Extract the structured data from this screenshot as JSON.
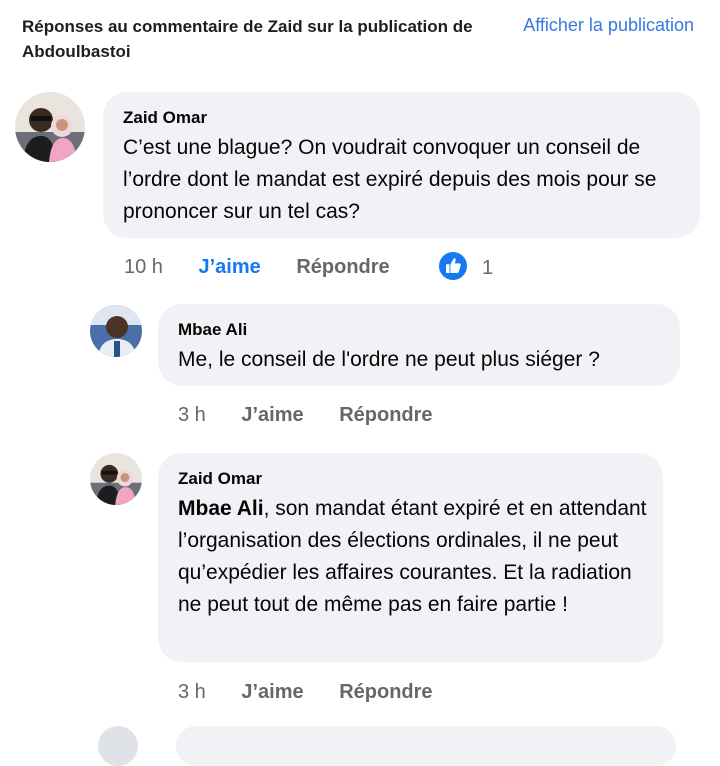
{
  "header": {
    "title": "Réponses au commentaire de Zaid sur la publication de Abdoulbastoi",
    "show_post": "Afficher la publication"
  },
  "comments": [
    {
      "author": "Zaid Omar",
      "text": "C’est une blague? On voudrait convoquer un conseil de l’ordre dont le mandat est expiré depuis des mois pour se prononcer sur un tel cas?",
      "time": "10 h",
      "like_label": "J’aime",
      "reply_label": "Répondre",
      "reactions_count": "1",
      "reaction_icon": "thumbs-up-icon"
    },
    {
      "author": "Mbae Ali",
      "text": "Me, le conseil de l'ordre ne peut plus siéger ?",
      "time": "3 h",
      "like_label": "J’aime",
      "reply_label": "Répondre"
    },
    {
      "author": "Zaid Omar",
      "mention": "Mbae Ali",
      "text": ", son mandat étant expiré et en attendant l’organisation des élections ordinales, il ne peut qu’expédier les affaires courantes. Et la radiation ne peut tout de même pas en faire partie !",
      "time": "3 h",
      "like_label": "J’aime",
      "reply_label": "Répondre"
    }
  ],
  "colors": {
    "link": "#3578e5",
    "like_active": "#1877f2",
    "bubble": "#f0f2f5",
    "meta": "#65676b"
  }
}
